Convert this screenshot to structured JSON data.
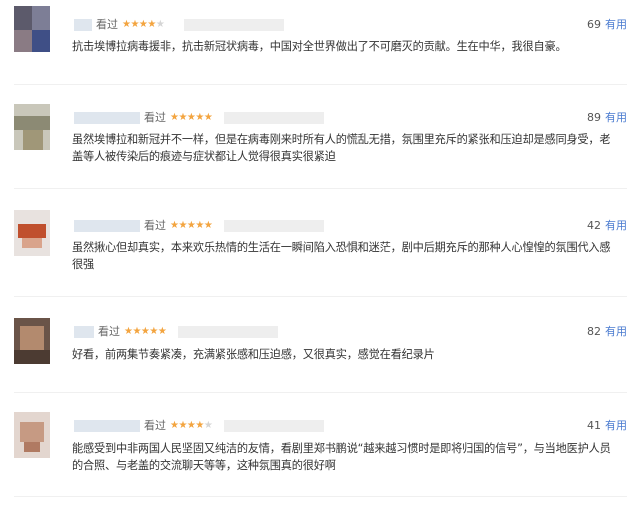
{
  "reviews": [
    {
      "seen_label": "看过",
      "stars": "★★★★",
      "stars_off": "★",
      "useful_count": "69",
      "useful_label": "有用",
      "content": "抗击埃博拉病毒援非，抗击新冠状病毒，中国对全世界做出了不可磨灭的贡献。生在中华，我很自豪。"
    },
    {
      "seen_label": "看过",
      "stars": "★★★★★",
      "stars_off": "",
      "useful_count": "89",
      "useful_label": "有用",
      "content": "虽然埃博拉和新冠并不一样，但是在病毒刚来时所有人的慌乱无措，氛围里充斥的紧张和压迫却是感同身受，老盖等人被传染后的痕迹与症状都让人觉得很真实很紧迫"
    },
    {
      "seen_label": "看过",
      "stars": "★★★★★",
      "stars_off": "",
      "useful_count": "42",
      "useful_label": "有用",
      "content": "虽然揪心但却真实，本来欢乐热情的生活在一瞬间陷入恐惧和迷茫，剧中后期充斥的那种人心惶惶的氛围代入感很强"
    },
    {
      "seen_label": "看过",
      "stars": "★★★★★",
      "stars_off": "",
      "useful_count": "82",
      "useful_label": "有用",
      "content": "好看，前两集节奏紧凑，充满紧张感和压迫感，又很真实，感觉在看纪录片"
    },
    {
      "seen_label": "看过",
      "stars": "★★★★",
      "stars_off": "★",
      "useful_count": "41",
      "useful_label": "有用",
      "content": "能感受到中非两国人民坚固又纯洁的友情，看剧里郑书鹏说“越来越习惯时是即将归国的信号”，与当地医护人员的合照、与老盖的交流聊天等等，这种氛围真的很好啊"
    }
  ],
  "colors": {
    "star_on": "#f3a43f",
    "star_off": "#d5d5d5",
    "useful_label": "#4a7bd0",
    "text": "#333333"
  }
}
